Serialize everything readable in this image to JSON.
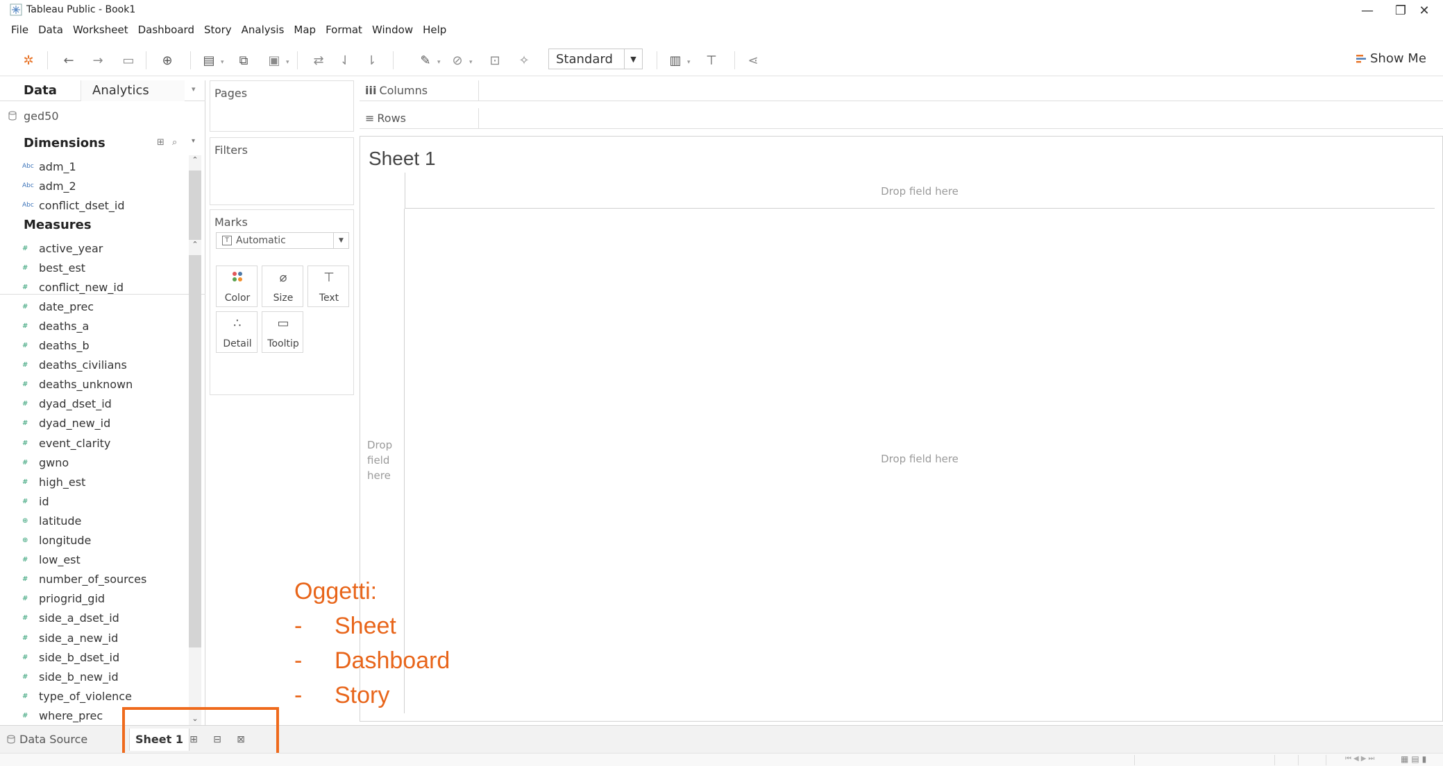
{
  "window": {
    "title": "Tableau Public - Book1",
    "controls": {
      "minimize": "—",
      "restore": "❐",
      "close": "✕"
    }
  },
  "menu": [
    "File",
    "Data",
    "Worksheet",
    "Dashboard",
    "Story",
    "Analysis",
    "Map",
    "Format",
    "Window",
    "Help"
  ],
  "toolbar": {
    "fit_select": "Standard",
    "show_me": "Show Me",
    "icons": [
      "tableau-logo-icon",
      "back-icon",
      "forward-icon",
      "save-icon",
      "new-datasource-icon",
      "new-worksheet-icon",
      "duplicate-icon",
      "clear-icon",
      "swap-icon",
      "sort-asc-icon",
      "sort-desc-icon",
      "highlight-icon",
      "group-icon",
      "label-icon",
      "pin-icon",
      "fit-icon",
      "presentation-icon",
      "share-icon"
    ],
    "accent_color": "#e8762b"
  },
  "data_pane": {
    "tabs": {
      "data": "Data",
      "analytics": "Analytics"
    },
    "datasource": "ged50",
    "dimensions_label": "Dimensions",
    "measures_label": "Measures",
    "dimensions": [
      {
        "type": "Abc",
        "name": "adm_1"
      },
      {
        "type": "Abc",
        "name": "adm_2"
      },
      {
        "type": "Abc",
        "name": "conflict_dset_id"
      }
    ],
    "measures": [
      {
        "type": "#",
        "name": "active_year"
      },
      {
        "type": "#",
        "name": "best_est"
      },
      {
        "type": "#",
        "name": "conflict_new_id"
      },
      {
        "type": "#",
        "name": "date_prec"
      },
      {
        "type": "#",
        "name": "deaths_a"
      },
      {
        "type": "#",
        "name": "deaths_b"
      },
      {
        "type": "#",
        "name": "deaths_civilians"
      },
      {
        "type": "#",
        "name": "deaths_unknown"
      },
      {
        "type": "#",
        "name": "dyad_dset_id"
      },
      {
        "type": "#",
        "name": "dyad_new_id"
      },
      {
        "type": "#",
        "name": "event_clarity"
      },
      {
        "type": "#",
        "name": "gwno"
      },
      {
        "type": "#",
        "name": "high_est"
      },
      {
        "type": "#",
        "name": "id"
      },
      {
        "type": "geo",
        "name": "latitude"
      },
      {
        "type": "geo",
        "name": "longitude"
      },
      {
        "type": "#",
        "name": "low_est"
      },
      {
        "type": "#",
        "name": "number_of_sources"
      },
      {
        "type": "#",
        "name": "priogrid_gid"
      },
      {
        "type": "#",
        "name": "side_a_dset_id"
      },
      {
        "type": "#",
        "name": "side_a_new_id"
      },
      {
        "type": "#",
        "name": "side_b_dset_id"
      },
      {
        "type": "#",
        "name": "side_b_new_id"
      },
      {
        "type": "#",
        "name": "type_of_violence"
      },
      {
        "type": "#",
        "name": "where_prec"
      }
    ]
  },
  "cards": {
    "pages": "Pages",
    "filters": "Filters",
    "marks": "Marks",
    "mark_type": "Automatic",
    "mark_buttons": [
      "Color",
      "Size",
      "Text",
      "Detail",
      "Tooltip"
    ]
  },
  "shelves": {
    "columns": "Columns",
    "rows": "Rows"
  },
  "canvas": {
    "sheet_title": "Sheet 1",
    "drop_columns": "Drop field here",
    "drop_rows": "Drop field here",
    "drop_pane": "Drop field here"
  },
  "bottom": {
    "data_source_tab": "Data Source",
    "sheet_tab": "Sheet 1"
  },
  "annotation": {
    "heading": "Oggetti:",
    "items": [
      "Sheet",
      "Dashboard",
      "Story"
    ],
    "color": "#e8651a"
  }
}
